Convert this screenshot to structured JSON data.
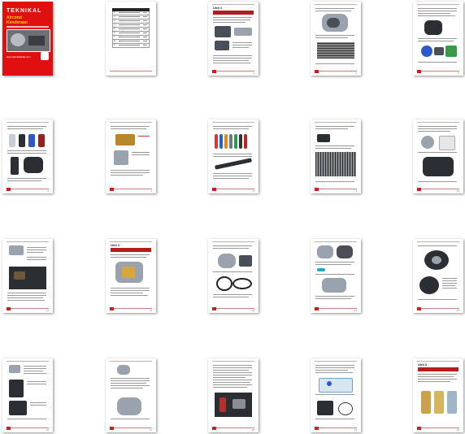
{
  "document": {
    "title": "TEKNIKAL",
    "subtitle_lines": [
      "Aircond",
      "Kenderaan"
    ],
    "cover_url": "www.teknikaldata.com",
    "unit_labels": [
      "Unit 1",
      "Unit 2",
      "Unit 3"
    ],
    "page_numbers": [
      "1",
      "2",
      "3",
      "4",
      "5",
      "6",
      "7",
      "8",
      "9",
      "10",
      "11",
      "12",
      "13",
      "14",
      "15",
      "16",
      "17",
      "18",
      "19",
      "20"
    ],
    "toc_rows": [
      {
        "n": "1"
      },
      {
        "n": "2"
      },
      {
        "n": "3"
      },
      {
        "n": "4"
      },
      {
        "n": "5"
      },
      {
        "n": "6"
      },
      {
        "n": "7"
      },
      {
        "n": "8"
      },
      {
        "n": "9"
      }
    ]
  },
  "colors": {
    "accent": "#e01010",
    "heading_bar": "#b31d1d",
    "subtitle": "#ffd200"
  }
}
